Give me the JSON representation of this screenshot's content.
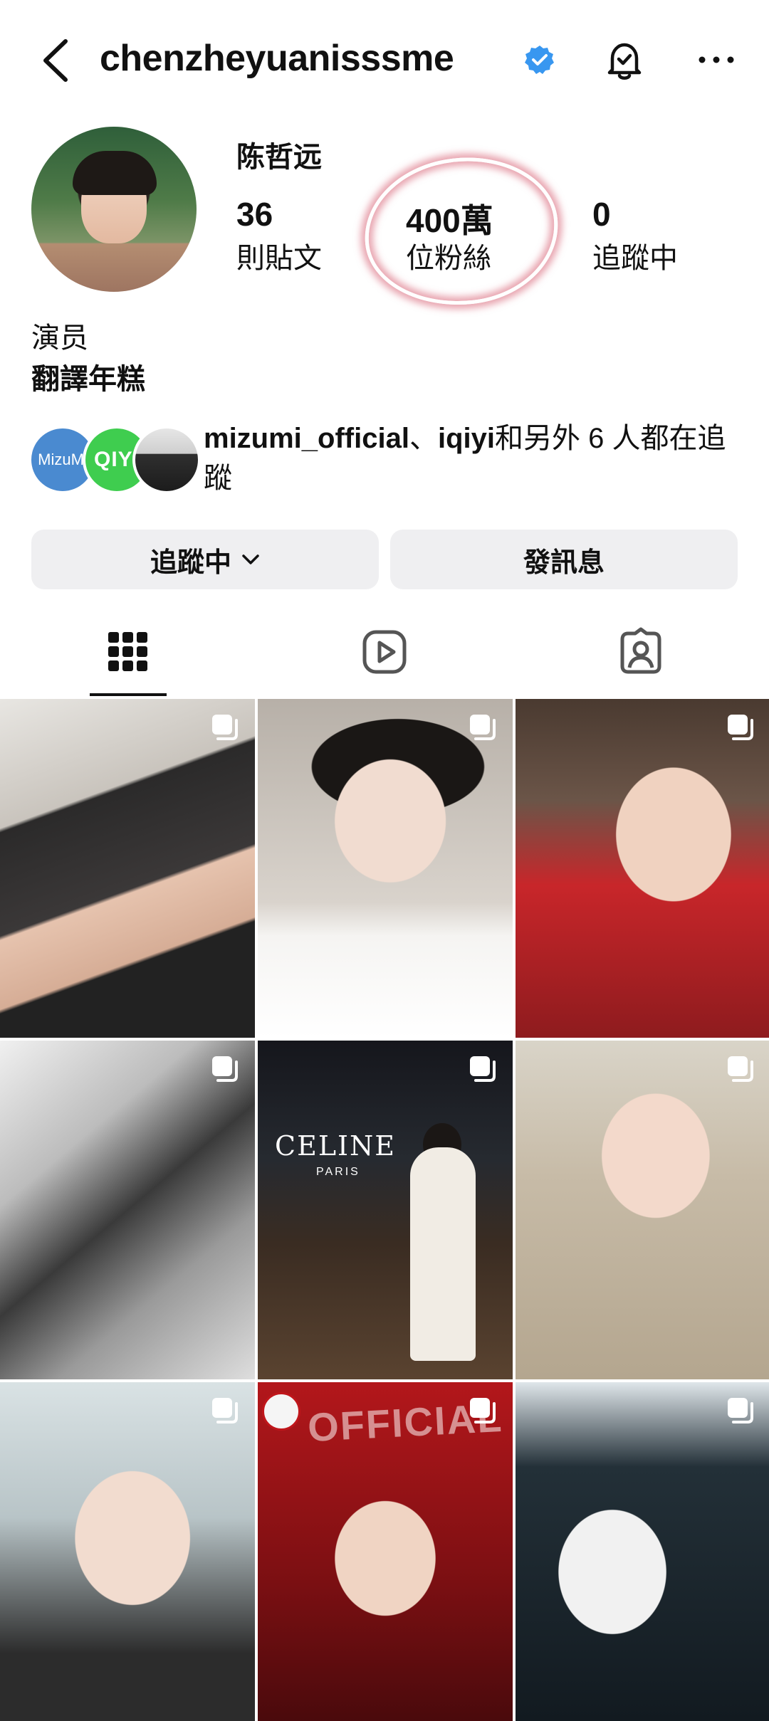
{
  "header": {
    "username": "chenzheyuanisssme",
    "verified": true,
    "back_icon": "chevron-left-icon",
    "bell_icon": "bell-check-icon",
    "more_icon": "ellipsis-icon"
  },
  "profile": {
    "display_name": "陈哲远",
    "posts_count": "36",
    "posts_label": "則貼文",
    "followers_count": "400萬",
    "followers_label": "位粉絲",
    "following_count": "0",
    "following_label": "追蹤中",
    "bio_line1": "演员",
    "bio_line2": "翻譯年糕"
  },
  "mutual": {
    "avatar1_text": "MizuMi",
    "avatar2_text": "QIYI",
    "name1": "mizumi_official",
    "sep": "、",
    "name2": "iqiyi",
    "rest": "和另外 6 人都在追蹤"
  },
  "actions": {
    "follow_label": "追蹤中",
    "follow_chevron": "⌄",
    "message_label": "發訊息"
  },
  "tabs": [
    "grid-icon",
    "reels-icon",
    "tagged-icon"
  ],
  "posts": {
    "p5_brand": "CELINE",
    "p5_sub": "PARIS",
    "p8_text": "OFFICIAL"
  },
  "colors": {
    "verified_blue": "#3897f0",
    "annotation": "#d65a6e",
    "button_bg": "#efeff1"
  }
}
